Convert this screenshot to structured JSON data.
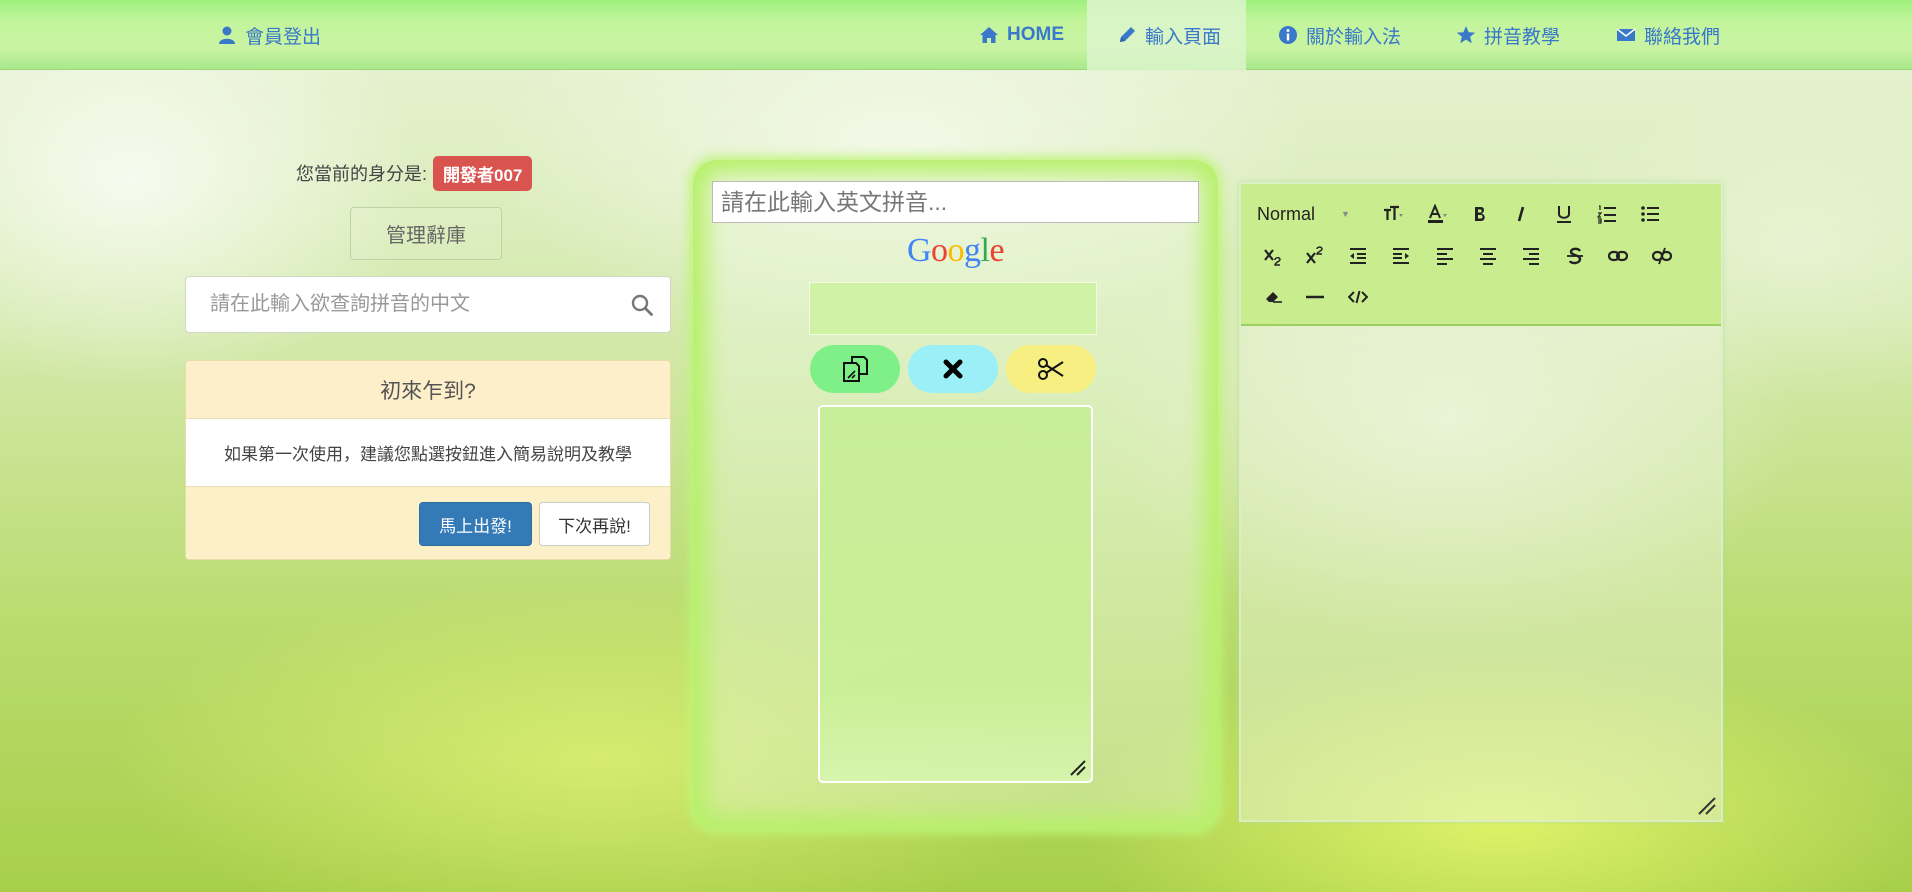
{
  "navbar": {
    "logout": {
      "label": "會員登出",
      "icon": "user-icon"
    },
    "home": {
      "label": "HOME",
      "icon": "home-icon"
    },
    "input_page": {
      "label": "輸入頁面",
      "icon": "pencil-icon",
      "active": true
    },
    "about": {
      "label": "關於輸入法",
      "icon": "info-circle-icon"
    },
    "tutorial": {
      "label": "拼音教學",
      "icon": "star-icon"
    },
    "contact": {
      "label": "聯絡我們",
      "icon": "envelope-icon"
    },
    "link_color": "#3a78c9"
  },
  "identity": {
    "prefix": "您當前的身分是:",
    "role_badge": "開發者007",
    "badge_color": "#d9534f"
  },
  "manage_button": "管理辭庫",
  "search": {
    "placeholder": "請在此輸入欲查詢拼音的中文",
    "value": "",
    "icon": "search-icon"
  },
  "welcome": {
    "title": "初來乍到?",
    "body": "如果第一次使用，建議您點選按鈕進入簡易說明及教學",
    "go_button": "馬上出發!",
    "later_button": "下次再說!"
  },
  "pinyin": {
    "placeholder": "請在此輸入英文拼音...",
    "value": "",
    "google_logo": "Google",
    "copy_icon": "copy-icon",
    "clear_icon": "close-icon",
    "cut_icon": "scissors-icon",
    "output_value": ""
  },
  "editor": {
    "style_value": "Normal",
    "tools": [
      "font-size-icon",
      "font-color-icon",
      "bold-icon",
      "italic-icon",
      "underline-icon",
      "ordered-list-icon",
      "unordered-list-icon",
      "subscript-icon",
      "superscript-icon",
      "outdent-icon",
      "indent-icon",
      "align-left-icon",
      "align-center-icon",
      "align-right-icon",
      "strikethrough-icon",
      "link-icon",
      "unlink-icon",
      "eraser-icon",
      "horizontal-rule-icon",
      "code-view-icon"
    ],
    "toolbar_color": "#c9ec8e"
  }
}
